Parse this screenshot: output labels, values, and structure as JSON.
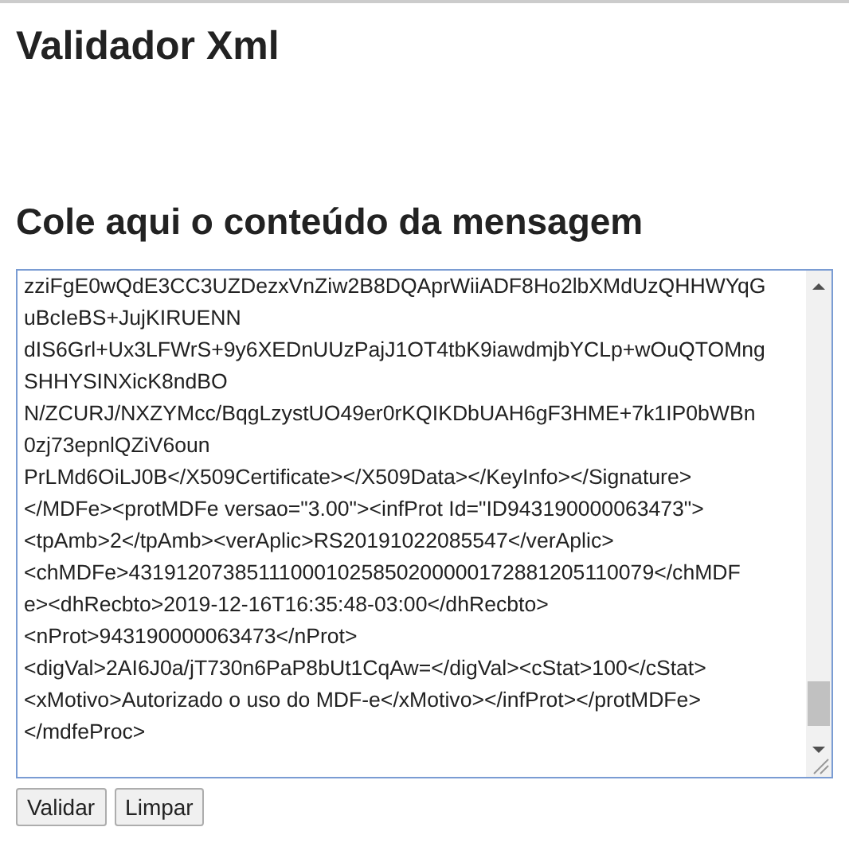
{
  "page": {
    "title": "Validador Xml",
    "section_title": "Cole aqui o conteúdo da mensagem"
  },
  "message": {
    "lines": [
      "zziFgE0wQdE3CC3UZDezxVnZiw2B8DQAprWiiADF8Ho2lbXMdUzQHHWYqG",
      "uBcIeBS+JujKIRUENN",
      "dIS6Grl+Ux3LFWrS+9y6XEDnUUzPajJ1OT4tbK9iawdmjbYCLp+wOuQTOMng",
      "SHHYSINXicK8ndBO",
      "N/ZCURJ/NXZYMcc/BqgLzystUO49er0rKQIKDbUAH6gF3HME+7k1IP0bWBn",
      "0zj73epnlQZiV6oun",
      "PrLMd6OiLJ0B</X509Certificate></X509Data></KeyInfo></Signature>",
      "</MDFe><protMDFe versao=\"3.00\"><infProt Id=\"ID943190000063473\">",
      "<tpAmb>2</tpAmb><verAplic>RS20191022085547</verAplic>",
      "<chMDFe>431912073851110001025850200000172881205110079</chMDF",
      "e><dhRecbto>2019-12-16T16:35:48-03:00</dhRecbto>",
      "<nProt>943190000063473</nProt>",
      "<digVal>2AI6J0a/jT730n6PaP8bUt1CqAw=</digVal><cStat>100</cStat>",
      "<xMotivo>Autorizado o uso do MDF-e</xMotivo></infProt></protMDFe>",
      "</mdfeProc>"
    ]
  },
  "buttons": [
    {
      "label": "Validar"
    },
    {
      "label": "Limpar"
    }
  ]
}
